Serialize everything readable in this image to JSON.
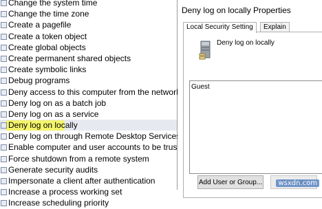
{
  "policy_list": {
    "items": [
      {
        "label": "Change the system time"
      },
      {
        "label": "Change the time zone"
      },
      {
        "label": "Create a pagefile"
      },
      {
        "label": "Create a token object"
      },
      {
        "label": "Create global objects"
      },
      {
        "label": "Create permanent shared objects"
      },
      {
        "label": "Create symbolic links"
      },
      {
        "label": "Debug programs"
      },
      {
        "label": "Deny access to this computer from the network"
      },
      {
        "label": "Deny log on as a batch job"
      },
      {
        "label": "Deny log on as a service"
      },
      {
        "label": "Deny log on locally"
      },
      {
        "label": "Deny log on through Remote Desktop Services"
      },
      {
        "label": "Enable computer and user accounts to be trusted for delega..."
      },
      {
        "label": "Force shutdown from a remote system"
      },
      {
        "label": "Generate security audits"
      },
      {
        "label": "Impersonate a client after authentication"
      },
      {
        "label": "Increase a process working set"
      },
      {
        "label": "Increase scheduling priority"
      }
    ],
    "selected_label": "Deny log on locally"
  },
  "dialog": {
    "title": "Deny log on locally Properties",
    "tabs": [
      {
        "label": "Local Security Setting"
      },
      {
        "label": "Explain"
      }
    ],
    "active_tab": "Local Security Setting",
    "policy_name": "Deny log on locally",
    "users": [
      "Guest"
    ],
    "add_button_label": "Add User or Group...",
    "remove_button_label": "Remove"
  },
  "watermark": "wsxdn.com",
  "colors": {
    "highlight_yellow": "#fffb00",
    "selected_row_bg": "#e6eaf0"
  }
}
